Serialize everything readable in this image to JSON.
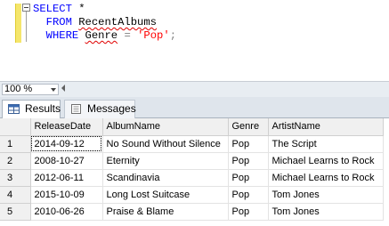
{
  "editor": {
    "lines": [
      {
        "kw": "SELECT",
        "rest": " *"
      },
      {
        "kw": "FROM",
        "rest": "RecentAlbums"
      },
      {
        "kw": "WHERE",
        "ident": "Genre",
        "op": "=",
        "str": "'Pop'",
        "end": ";"
      }
    ]
  },
  "zoom": {
    "value": "100 %"
  },
  "tabs": [
    {
      "label": "Results",
      "icon": "grid-icon",
      "active": true
    },
    {
      "label": "Messages",
      "icon": "messages-icon",
      "active": false
    }
  ],
  "results": {
    "columns": [
      "ReleaseDate",
      "AlbumName",
      "Genre",
      "ArtistName"
    ],
    "rows": [
      {
        "num": "1",
        "cells": [
          "2014-09-12",
          "No Sound Without Silence",
          "Pop",
          "The Script"
        ]
      },
      {
        "num": "2",
        "cells": [
          "2008-10-27",
          "Eternity",
          "Pop",
          "Michael Learns to Rock"
        ]
      },
      {
        "num": "3",
        "cells": [
          "2012-06-11",
          "Scandinavia",
          "Pop",
          "Michael Learns to Rock"
        ]
      },
      {
        "num": "4",
        "cells": [
          "2015-10-09",
          "Long Lost Suitcase",
          "Pop",
          "Tom Jones"
        ]
      },
      {
        "num": "5",
        "cells": [
          "2010-06-26",
          "Praise & Blame",
          "Pop",
          "Tom Jones"
        ]
      }
    ]
  }
}
